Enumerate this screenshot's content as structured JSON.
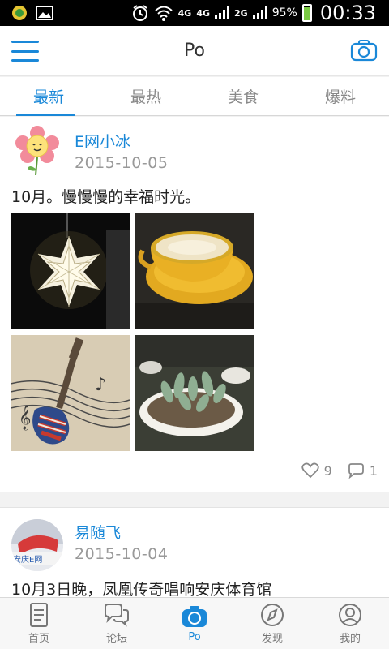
{
  "status_bar": {
    "network_1": "4G",
    "network_2": "4G",
    "network_3": "2G",
    "battery": "95%",
    "time": "00:33"
  },
  "header": {
    "title": "Po",
    "menu_icon": "menu-icon",
    "camera_icon": "camera-icon"
  },
  "tabs": [
    {
      "label": "最新",
      "active": true
    },
    {
      "label": "最热",
      "active": false
    },
    {
      "label": "美食",
      "active": false
    },
    {
      "label": "爆料",
      "active": false
    }
  ],
  "posts": [
    {
      "user": "E网小冰",
      "date": "2015-10-05",
      "text": "10月。慢慢慢的幸福时光。",
      "likes": "9",
      "comments": "1",
      "photos": [
        "star-lamp",
        "coffee-cup",
        "guitar-wall-art",
        "succulent-plants"
      ]
    },
    {
      "user": "易随飞",
      "date": "2015-10-04",
      "text": "10月3日晚，凤凰传奇唱响安庆体育馆"
    }
  ],
  "bottom_nav": [
    {
      "label": "首页",
      "icon": "document-icon",
      "active": false
    },
    {
      "label": "论坛",
      "icon": "chat-bubbles-icon",
      "active": false
    },
    {
      "label": "Po",
      "icon": "camera-icon",
      "active": true
    },
    {
      "label": "发现",
      "icon": "compass-icon",
      "active": false
    },
    {
      "label": "我的",
      "icon": "user-icon",
      "active": false
    }
  ],
  "colors": {
    "accent": "#1a88d8",
    "text_muted": "#999999",
    "background": "#f2f2f2"
  }
}
